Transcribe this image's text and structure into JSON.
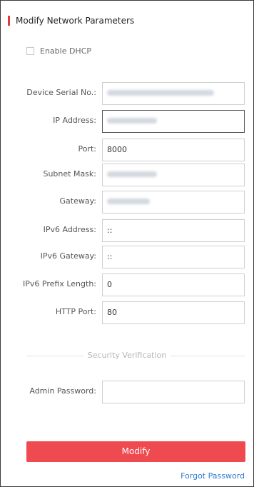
{
  "title": "Modify Network Parameters",
  "dhcp": {
    "label": "Enable DHCP",
    "checked": false
  },
  "fields": {
    "serial": {
      "label": "Device Serial No.:",
      "value": ""
    },
    "ip": {
      "label": "IP Address:",
      "value": ""
    },
    "port": {
      "label": "Port:",
      "value": "8000"
    },
    "subnet": {
      "label": "Subnet Mask:",
      "value": ""
    },
    "gateway": {
      "label": "Gateway:",
      "value": ""
    },
    "ipv6": {
      "label": "IPv6 Address:",
      "value": "::"
    },
    "ipv6gw": {
      "label": "IPv6 Gateway:",
      "value": "::"
    },
    "ipv6prefix": {
      "label": "IPv6 Prefix Length:",
      "value": "0"
    },
    "http": {
      "label": "HTTP Port:",
      "value": "80"
    }
  },
  "security": {
    "title": "Security Verification",
    "password_label": "Admin Password:",
    "password_value": ""
  },
  "actions": {
    "modify": "Modify",
    "forgot": "Forgot Password"
  },
  "colors": {
    "accent": "#ef4a4f",
    "link": "#2f7bd0",
    "header_bar": "#e03a3a"
  }
}
